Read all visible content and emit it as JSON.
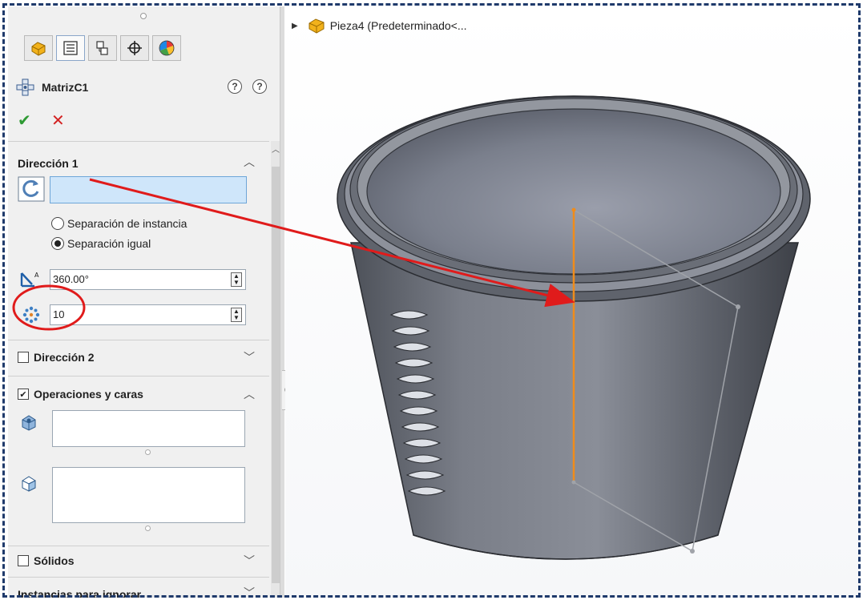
{
  "feature": {
    "title": "MatrizC1"
  },
  "direction1": {
    "label": "Dirección 1",
    "radio_instance": "Separación de instancia",
    "radio_equal": "Separación igual",
    "angle": "360.00°",
    "instances": "10"
  },
  "direction2": {
    "label": "Dirección 2"
  },
  "features_faces": {
    "label": "Operaciones y caras"
  },
  "bodies": {
    "label": "Sólidos"
  },
  "skip": {
    "label": "Instancias para ignorar"
  },
  "tree": {
    "part_label": "Pieza4  (Predeterminado<..."
  },
  "colors": {
    "accent_red": "#e01b1b",
    "axis_orange": "#f08c1a",
    "part_gray": "#6f737d"
  }
}
